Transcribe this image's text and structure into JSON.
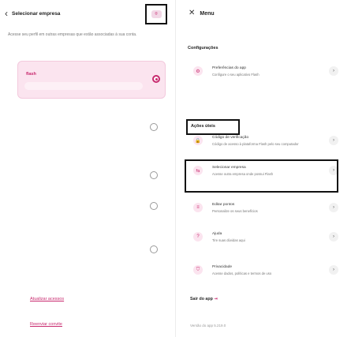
{
  "left": {
    "back_chevron": "‹",
    "title": "Selecionar empresa",
    "top_icon": "⌾",
    "subtitle": "Acesse seu perfil em outras empresas que estão associadas à sua conta.",
    "selected_company": "flash",
    "update_access": "Atualizar acessos",
    "resend_invite": "Reenviar convite"
  },
  "right": {
    "close_icon": "✕",
    "title": "Menu",
    "section_settings": "Configurações",
    "section_useful": "Ações úteis",
    "items": [
      {
        "icon": "⚙",
        "title": "Preferências do app",
        "desc": "Configure o seu aplicativo Flash"
      },
      {
        "icon": "🔒",
        "title": "Código de verificação",
        "desc": "Código de acesso à plataforma Flash pelo seu computador"
      },
      {
        "icon": "⇆",
        "title": "Selecionar empresa",
        "desc": "Acesse outra empresa onde possui Flash"
      },
      {
        "icon": "≡",
        "title": "Editar pontos",
        "desc": "Personalize os seus benefícios"
      },
      {
        "icon": "?",
        "title": "Ajuda",
        "desc": "Tire suas dúvidas aqui"
      },
      {
        "icon": "⛉",
        "title": "Privacidade",
        "desc": "Acesse dados, políticas e termos de uso"
      }
    ],
    "go_icon": "›",
    "logout": "Sair do app",
    "logout_icon": "⇥",
    "version": "Versão do app 5.219.0"
  }
}
